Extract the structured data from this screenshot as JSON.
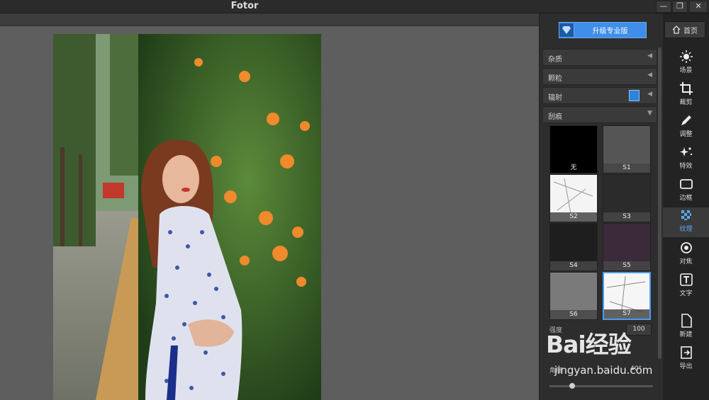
{
  "window": {
    "title": "Fotor"
  },
  "panel": {
    "upgrade_label": "升级专业版",
    "sections": [
      {
        "label": "杂质",
        "vip": false
      },
      {
        "label": "颗粒",
        "vip": false
      },
      {
        "label": "辐射",
        "vip": true
      },
      {
        "label": "刮痕",
        "vip": false,
        "expanded": true
      }
    ],
    "textures": [
      {
        "label": "无",
        "selected": false
      },
      {
        "label": "S1",
        "selected": false
      },
      {
        "label": "S2",
        "selected": false
      },
      {
        "label": "S3",
        "selected": false
      },
      {
        "label": "S4",
        "selected": false
      },
      {
        "label": "S5",
        "selected": false
      },
      {
        "label": "S6",
        "selected": false
      },
      {
        "label": "S7",
        "selected": true
      }
    ],
    "strength_label": "强度",
    "strength_value": "100",
    "angle_label": "角度",
    "angle_value": "40°"
  },
  "sidebar": {
    "home_label": "首页",
    "tools": [
      {
        "label": "场景",
        "icon": "sun-icon"
      },
      {
        "label": "裁剪",
        "icon": "crop-icon"
      },
      {
        "label": "调整",
        "icon": "pencil-icon"
      },
      {
        "label": "特效",
        "icon": "sparkle-icon"
      },
      {
        "label": "边框",
        "icon": "frame-icon"
      },
      {
        "label": "纹理",
        "icon": "texture-icon",
        "active": true
      },
      {
        "label": "对焦",
        "icon": "focus-icon"
      },
      {
        "label": "文字",
        "icon": "text-icon"
      },
      {
        "label": "新建",
        "icon": "new-file-icon"
      },
      {
        "label": "导出",
        "icon": "export-icon"
      }
    ]
  },
  "watermark": {
    "text": "Bai经验",
    "sub": "jingyan.baidu.com"
  },
  "colors": {
    "accent": "#3f8ee9",
    "active_tool": "#5aa7f5"
  }
}
